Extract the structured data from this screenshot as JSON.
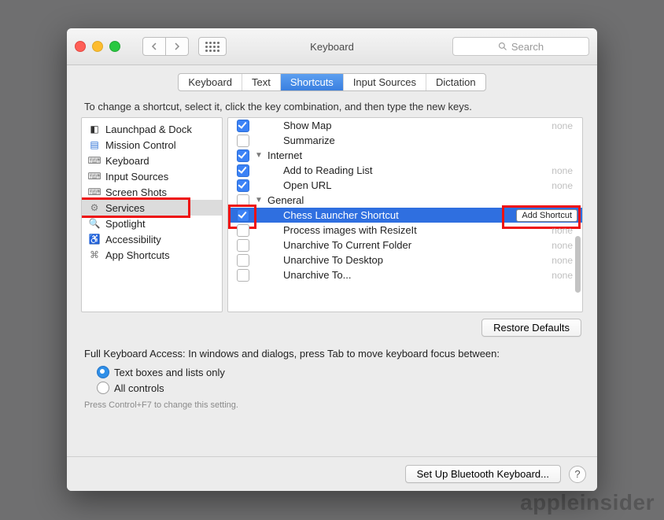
{
  "window": {
    "title": "Keyboard"
  },
  "search": {
    "placeholder": "Search"
  },
  "tabs": [
    {
      "label": "Keyboard",
      "active": false
    },
    {
      "label": "Text",
      "active": false
    },
    {
      "label": "Shortcuts",
      "active": true
    },
    {
      "label": "Input Sources",
      "active": false
    },
    {
      "label": "Dictation",
      "active": false
    }
  ],
  "instruction": "To change a shortcut, select it, click the key combination, and then type the new keys.",
  "categories": [
    {
      "label": "Launchpad & Dock",
      "icon": "launchpad"
    },
    {
      "label": "Mission Control",
      "icon": "mission"
    },
    {
      "label": "Keyboard",
      "icon": "keyboard"
    },
    {
      "label": "Input Sources",
      "icon": "keyboard"
    },
    {
      "label": "Screen Shots",
      "icon": "keyboard"
    },
    {
      "label": "Services",
      "icon": "gear",
      "selected": true,
      "highlight": true
    },
    {
      "label": "Spotlight",
      "icon": "spotlight"
    },
    {
      "label": "Accessibility",
      "icon": "accessibility"
    },
    {
      "label": "App Shortcuts",
      "icon": "apps"
    }
  ],
  "services": [
    {
      "type": "item",
      "checked": true,
      "label": "Show Map",
      "shortcut": "none"
    },
    {
      "type": "item",
      "checked": false,
      "label": "Summarize",
      "shortcut": ""
    },
    {
      "type": "header",
      "checked": true,
      "label": "Internet",
      "open": true
    },
    {
      "type": "item",
      "checked": true,
      "label": "Add to Reading List",
      "shortcut": "none"
    },
    {
      "type": "item",
      "checked": true,
      "label": "Open URL",
      "shortcut": "none"
    },
    {
      "type": "header",
      "checked": false,
      "label": "General",
      "open": true
    },
    {
      "type": "item",
      "checked": true,
      "label": "Chess Launcher Shortcut",
      "shortcut": "",
      "selected": true,
      "highlightChk": true,
      "addShortcut": true
    },
    {
      "type": "item",
      "checked": false,
      "label": "Process images with ResizeIt",
      "shortcut": "none"
    },
    {
      "type": "item",
      "checked": false,
      "label": "Unarchive To Current Folder",
      "shortcut": "none"
    },
    {
      "type": "item",
      "checked": false,
      "label": "Unarchive To Desktop",
      "shortcut": "none"
    },
    {
      "type": "item",
      "checked": false,
      "label": "Unarchive To...",
      "shortcut": "none"
    }
  ],
  "addShortcutLabel": "Add Shortcut",
  "restoreDefaults": "Restore Defaults",
  "fullKeyboardAccess": {
    "label": "Full Keyboard Access: In windows and dialogs, press Tab to move keyboard focus between:",
    "options": [
      {
        "label": "Text boxes and lists only",
        "selected": true
      },
      {
        "label": "All controls",
        "selected": false
      }
    ],
    "hint": "Press Control+F7 to change this setting."
  },
  "footer": {
    "bluetooth": "Set Up Bluetooth Keyboard..."
  },
  "watermark": "appleinsider"
}
